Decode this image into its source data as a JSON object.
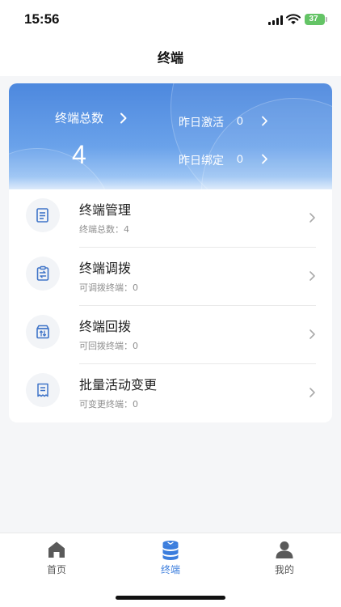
{
  "status_bar": {
    "time": "15:56",
    "battery_level": "37"
  },
  "nav": {
    "title": "终端"
  },
  "summary": {
    "total_label": "终端总数",
    "total_value": "4",
    "stats": [
      {
        "label": "昨日激活",
        "value": "0"
      },
      {
        "label": "昨日绑定",
        "value": "0"
      }
    ]
  },
  "menu": [
    {
      "title": "终端管理",
      "subtitle": "终端总数：4",
      "icon": "document-list-icon"
    },
    {
      "title": "终端调拨",
      "subtitle": "可调拨终端：0",
      "icon": "clipboard-transfer-icon"
    },
    {
      "title": "终端回拨",
      "subtitle": "可回拨终端：0",
      "icon": "box-return-icon"
    },
    {
      "title": "批量活动变更",
      "subtitle": "可变更终端：0",
      "icon": "receipt-icon"
    }
  ],
  "tabs": [
    {
      "label": "首页",
      "icon": "home-icon",
      "active": false
    },
    {
      "label": "终端",
      "icon": "terminal-stack-icon",
      "active": true
    },
    {
      "label": "我的",
      "icon": "user-icon",
      "active": false
    }
  ],
  "colors": {
    "accent": "#3b7ddd",
    "banner_top": "#4d88de",
    "banner_bottom": "#dbeafb",
    "tab_inactive": "#555555"
  }
}
